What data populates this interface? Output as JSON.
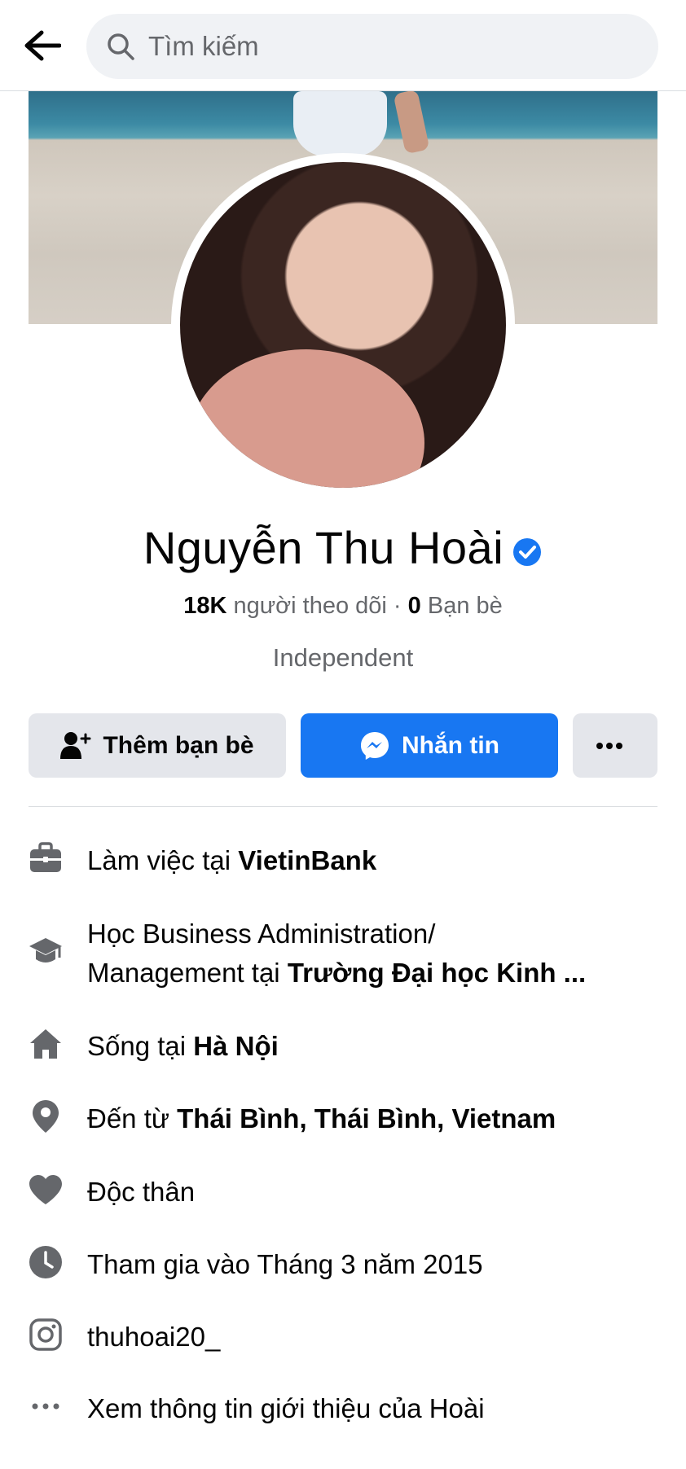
{
  "search": {
    "placeholder": "Tìm kiếm"
  },
  "profile": {
    "name": "Nguyễn Thu Hoài",
    "followers_count": "18K",
    "followers_label": "người theo dõi",
    "separator": "·",
    "friends_count": "0",
    "friends_label": "Bạn bè",
    "bio": "Independent"
  },
  "actions": {
    "add_friend": "Thêm bạn bè",
    "message": "Nhắn tin"
  },
  "details": {
    "work_prefix": "Làm việc tại ",
    "work_place": "VietinBank",
    "study_prefix_line1": "Học Business Administration/",
    "study_prefix_line2": "Management tại ",
    "study_place": "Trường Đại học Kinh ...",
    "live_prefix": "Sống tại ",
    "live_place": "Hà Nội",
    "from_prefix": "Đến từ ",
    "from_place": "Thái Bình, Thái Bình, Vietnam",
    "relationship": "Độc thân",
    "joined": "Tham gia vào Tháng 3 năm 2015",
    "instagram": "thuhoai20_",
    "see_about": "Xem thông tin giới thiệu của Hoài"
  },
  "colors": {
    "accent": "#1877f2",
    "button_gray": "#e4e6eb",
    "icon_gray": "#65676b"
  }
}
